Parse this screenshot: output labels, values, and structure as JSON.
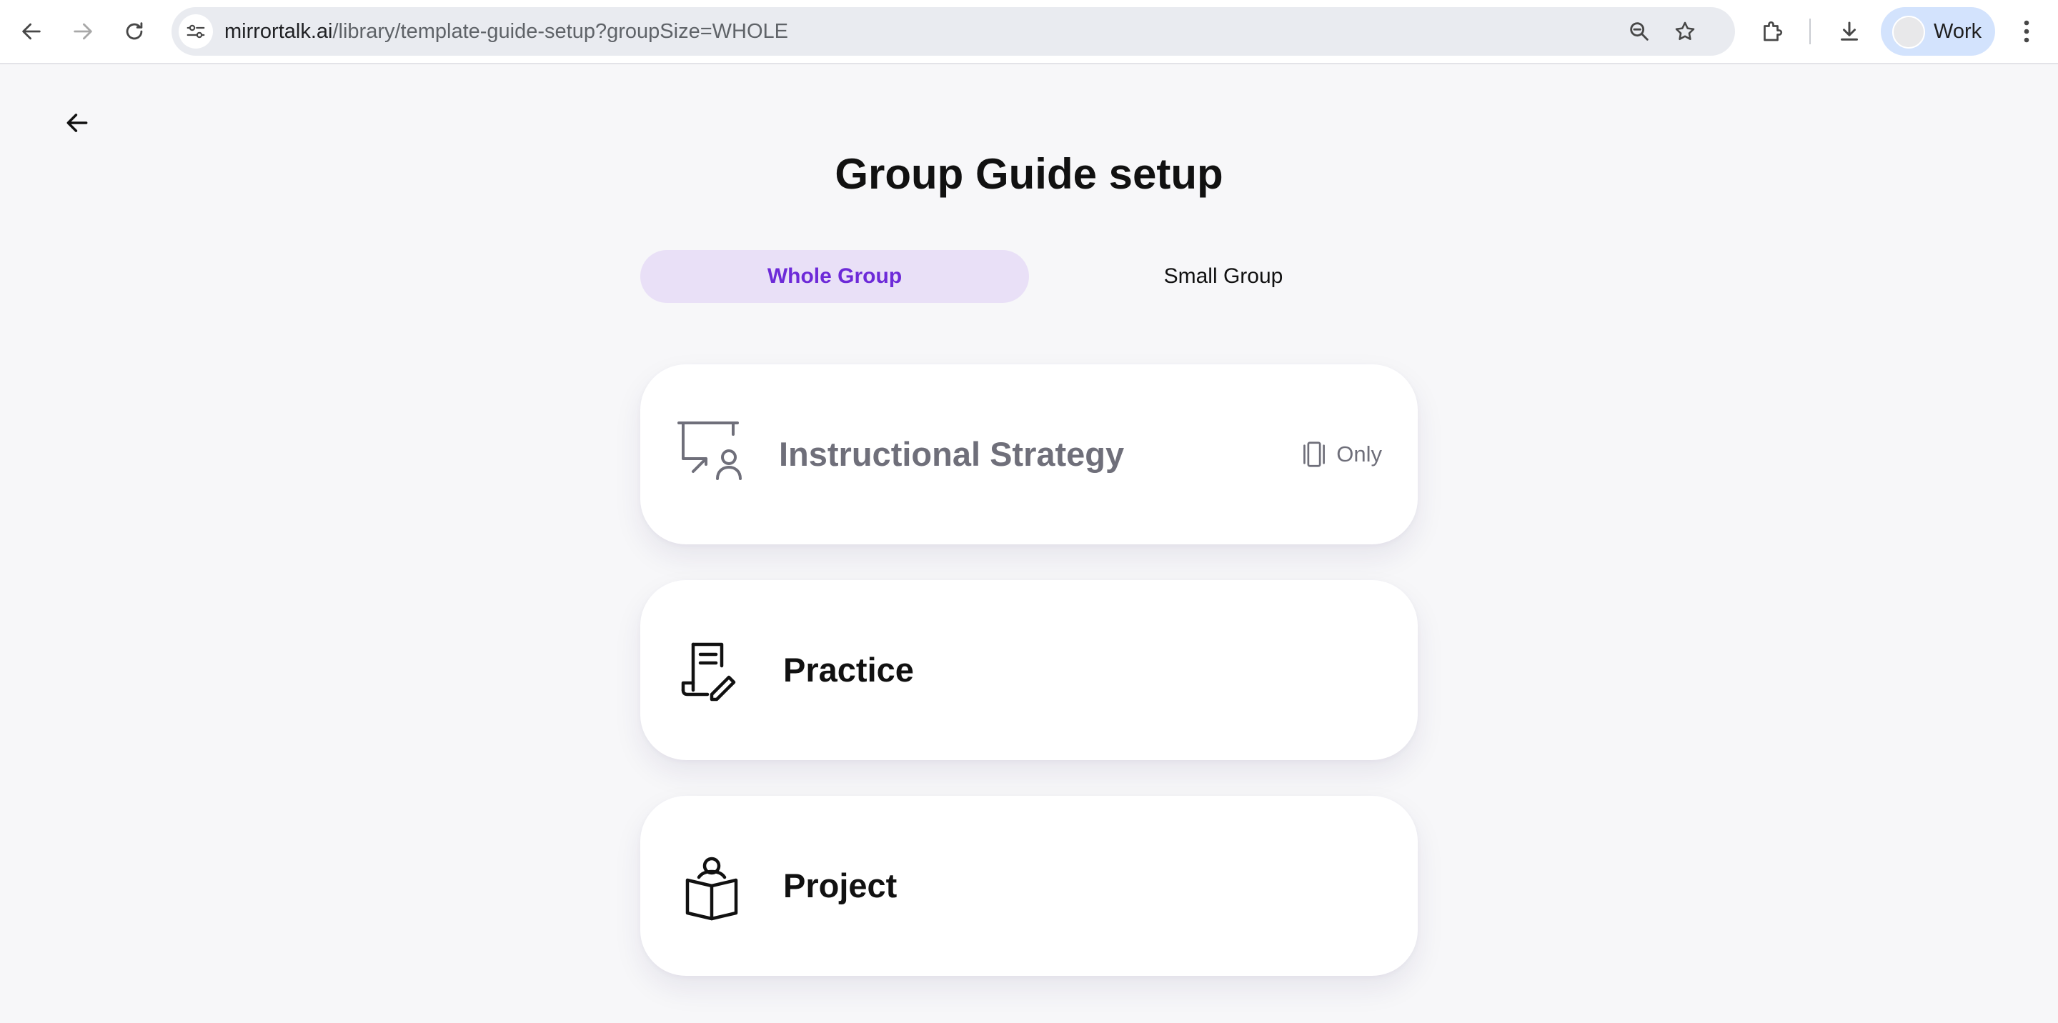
{
  "browser": {
    "url_host": "mirrortalk.ai",
    "url_path": "/library/template-guide-setup?groupSize=WHOLE",
    "profile_label": "Work",
    "icons": {
      "back": "arrow-left-icon",
      "forward": "arrow-right-icon",
      "reload": "reload-icon",
      "site_info": "tune-icon",
      "zoom": "zoom-out-icon",
      "bookmark": "star-icon",
      "extensions": "puzzle-icon",
      "downloads": "download-icon",
      "menu": "kebab-menu-icon"
    }
  },
  "page": {
    "title": "Group Guide setup",
    "back_icon": "arrow-left-icon",
    "tabs": [
      {
        "label": "Whole Group",
        "active": true
      },
      {
        "label": "Small Group",
        "active": false
      }
    ],
    "cards": [
      {
        "label": "Instructional Strategy",
        "icon": "presentation-board-icon",
        "disabled": true,
        "badge": "Only",
        "badge_icon": "device-icon"
      },
      {
        "label": "Practice",
        "icon": "document-pen-icon",
        "disabled": false
      },
      {
        "label": "Project",
        "icon": "reader-book-icon",
        "disabled": false
      }
    ]
  },
  "colors": {
    "accent": "#6d2ad8",
    "accent_bg": "#e9e0f7",
    "page_bg": "#f7f7f9",
    "muted_text": "#6f6f7a"
  }
}
